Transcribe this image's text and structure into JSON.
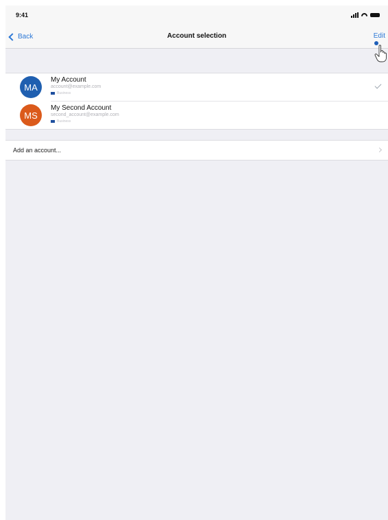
{
  "status_bar": {
    "time": "9:41"
  },
  "nav": {
    "back_label": "Back",
    "title": "Account selection",
    "edit_label": "Edit"
  },
  "accounts": [
    {
      "initials": "MA",
      "name": "My Account",
      "email": "account@example.com",
      "tag": "Business",
      "color": "#1f5fb0",
      "selected": true
    },
    {
      "initials": "MS",
      "name": "My Second Account",
      "email": "second_account@example.com",
      "tag": "Business",
      "color": "#db5a1b",
      "selected": false
    }
  ],
  "add_account": {
    "label": "Add an account..."
  },
  "colors": {
    "accent": "#2b77d6",
    "background": "#efeff4"
  }
}
